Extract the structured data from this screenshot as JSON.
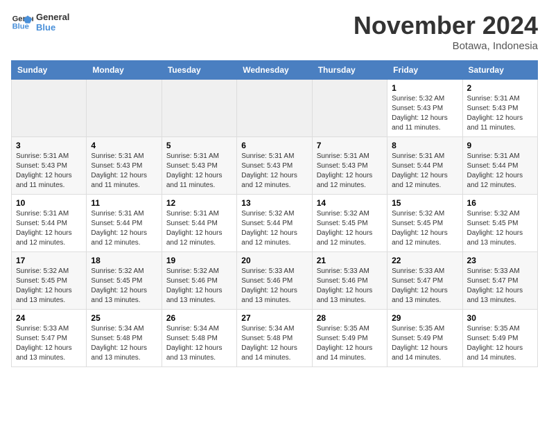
{
  "logo": {
    "line1": "General",
    "line2": "Blue"
  },
  "title": "November 2024",
  "location": "Botawa, Indonesia",
  "days_of_week": [
    "Sunday",
    "Monday",
    "Tuesday",
    "Wednesday",
    "Thursday",
    "Friday",
    "Saturday"
  ],
  "weeks": [
    [
      {
        "day": "",
        "info": ""
      },
      {
        "day": "",
        "info": ""
      },
      {
        "day": "",
        "info": ""
      },
      {
        "day": "",
        "info": ""
      },
      {
        "day": "",
        "info": ""
      },
      {
        "day": "1",
        "info": "Sunrise: 5:32 AM\nSunset: 5:43 PM\nDaylight: 12 hours and 11 minutes."
      },
      {
        "day": "2",
        "info": "Sunrise: 5:31 AM\nSunset: 5:43 PM\nDaylight: 12 hours and 11 minutes."
      }
    ],
    [
      {
        "day": "3",
        "info": "Sunrise: 5:31 AM\nSunset: 5:43 PM\nDaylight: 12 hours and 11 minutes."
      },
      {
        "day": "4",
        "info": "Sunrise: 5:31 AM\nSunset: 5:43 PM\nDaylight: 12 hours and 11 minutes."
      },
      {
        "day": "5",
        "info": "Sunrise: 5:31 AM\nSunset: 5:43 PM\nDaylight: 12 hours and 11 minutes."
      },
      {
        "day": "6",
        "info": "Sunrise: 5:31 AM\nSunset: 5:43 PM\nDaylight: 12 hours and 12 minutes."
      },
      {
        "day": "7",
        "info": "Sunrise: 5:31 AM\nSunset: 5:43 PM\nDaylight: 12 hours and 12 minutes."
      },
      {
        "day": "8",
        "info": "Sunrise: 5:31 AM\nSunset: 5:44 PM\nDaylight: 12 hours and 12 minutes."
      },
      {
        "day": "9",
        "info": "Sunrise: 5:31 AM\nSunset: 5:44 PM\nDaylight: 12 hours and 12 minutes."
      }
    ],
    [
      {
        "day": "10",
        "info": "Sunrise: 5:31 AM\nSunset: 5:44 PM\nDaylight: 12 hours and 12 minutes."
      },
      {
        "day": "11",
        "info": "Sunrise: 5:31 AM\nSunset: 5:44 PM\nDaylight: 12 hours and 12 minutes."
      },
      {
        "day": "12",
        "info": "Sunrise: 5:31 AM\nSunset: 5:44 PM\nDaylight: 12 hours and 12 minutes."
      },
      {
        "day": "13",
        "info": "Sunrise: 5:32 AM\nSunset: 5:44 PM\nDaylight: 12 hours and 12 minutes."
      },
      {
        "day": "14",
        "info": "Sunrise: 5:32 AM\nSunset: 5:45 PM\nDaylight: 12 hours and 12 minutes."
      },
      {
        "day": "15",
        "info": "Sunrise: 5:32 AM\nSunset: 5:45 PM\nDaylight: 12 hours and 12 minutes."
      },
      {
        "day": "16",
        "info": "Sunrise: 5:32 AM\nSunset: 5:45 PM\nDaylight: 12 hours and 13 minutes."
      }
    ],
    [
      {
        "day": "17",
        "info": "Sunrise: 5:32 AM\nSunset: 5:45 PM\nDaylight: 12 hours and 13 minutes."
      },
      {
        "day": "18",
        "info": "Sunrise: 5:32 AM\nSunset: 5:45 PM\nDaylight: 12 hours and 13 minutes."
      },
      {
        "day": "19",
        "info": "Sunrise: 5:32 AM\nSunset: 5:46 PM\nDaylight: 12 hours and 13 minutes."
      },
      {
        "day": "20",
        "info": "Sunrise: 5:33 AM\nSunset: 5:46 PM\nDaylight: 12 hours and 13 minutes."
      },
      {
        "day": "21",
        "info": "Sunrise: 5:33 AM\nSunset: 5:46 PM\nDaylight: 12 hours and 13 minutes."
      },
      {
        "day": "22",
        "info": "Sunrise: 5:33 AM\nSunset: 5:47 PM\nDaylight: 12 hours and 13 minutes."
      },
      {
        "day": "23",
        "info": "Sunrise: 5:33 AM\nSunset: 5:47 PM\nDaylight: 12 hours and 13 minutes."
      }
    ],
    [
      {
        "day": "24",
        "info": "Sunrise: 5:33 AM\nSunset: 5:47 PM\nDaylight: 12 hours and 13 minutes."
      },
      {
        "day": "25",
        "info": "Sunrise: 5:34 AM\nSunset: 5:48 PM\nDaylight: 12 hours and 13 minutes."
      },
      {
        "day": "26",
        "info": "Sunrise: 5:34 AM\nSunset: 5:48 PM\nDaylight: 12 hours and 13 minutes."
      },
      {
        "day": "27",
        "info": "Sunrise: 5:34 AM\nSunset: 5:48 PM\nDaylight: 12 hours and 14 minutes."
      },
      {
        "day": "28",
        "info": "Sunrise: 5:35 AM\nSunset: 5:49 PM\nDaylight: 12 hours and 14 minutes."
      },
      {
        "day": "29",
        "info": "Sunrise: 5:35 AM\nSunset: 5:49 PM\nDaylight: 12 hours and 14 minutes."
      },
      {
        "day": "30",
        "info": "Sunrise: 5:35 AM\nSunset: 5:49 PM\nDaylight: 12 hours and 14 minutes."
      }
    ]
  ]
}
